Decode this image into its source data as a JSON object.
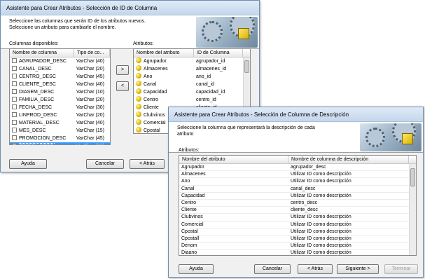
{
  "win1": {
    "title": "Asistente para Crear Atributos - Selección de ID de Columna",
    "banner_line1": "Seleccione las columnas que serán ID de los atributos nuevos.",
    "banner_line2": "Seleccione un atributo para cambiarle el nombre.",
    "columns_label": "Columnas disponibles:",
    "attrs_label": "Atributos:",
    "col_headers": [
      "Nombre de columna",
      "Tipo de co..."
    ],
    "columns": [
      {
        "name": "AGRUPADOR_DESC",
        "type": "VarChar (40)"
      },
      {
        "name": "CANAL_DESC",
        "type": "VarChar (20)"
      },
      {
        "name": "CENTRO_DESC",
        "type": "VarChar (45)"
      },
      {
        "name": "CLIENTE_DESC",
        "type": "VarChar (40)"
      },
      {
        "name": "DIASEM_DESC",
        "type": "VarChar (10)"
      },
      {
        "name": "FAMILIA_DESC",
        "type": "VarChar (20)"
      },
      {
        "name": "FECHA_DESC",
        "type": "VarChar (30)"
      },
      {
        "name": "LINPROD_DESC",
        "type": "VarChar (20)"
      },
      {
        "name": "MATERIAL_DESC",
        "type": "VarChar (40)"
      },
      {
        "name": "MES_DESC",
        "type": "VarChar (15)"
      },
      {
        "name": "PROMOCION_DESC",
        "type": "VarChar (45)"
      },
      {
        "name": "TIPOCL_DESC",
        "type": "VarChar (20)"
      }
    ],
    "attr_headers": [
      "Nombre del atributo",
      "ID de Columna"
    ],
    "attributes": [
      {
        "name": "Agrupador",
        "id": "agrupador_id"
      },
      {
        "name": "Almacenes",
        "id": "almacenes_id"
      },
      {
        "name": "Ano",
        "id": "ano_id"
      },
      {
        "name": "Canal",
        "id": "canal_id"
      },
      {
        "name": "Capacidad",
        "id": "capacidad_id"
      },
      {
        "name": "Centro",
        "id": "centro_id"
      },
      {
        "name": "Cliente",
        "id": "cliente_id"
      },
      {
        "name": "Clubvinos",
        "id": ""
      },
      {
        "name": "Comercial",
        "id": ""
      },
      {
        "name": "Cpostal",
        "id": ""
      },
      {
        "name": "Cpostal",
        "id": ""
      }
    ],
    "move_right": ">",
    "move_left": "<",
    "btn_help": "Ayuda",
    "btn_cancel": "Cancelar",
    "btn_back": "< Atrás"
  },
  "win2": {
    "title": "Asistente para Crear Atributos - Selección de Columna de Descripción",
    "banner_line1": "Seleccione la columna que representará la descripción de cada",
    "banner_line2": "atributo",
    "attrs_label": "Atributos:",
    "headers": [
      "Nombre del atributo",
      "Nombre de columna de descripción"
    ],
    "rows": [
      {
        "name": "Agrupador",
        "desc": "agrupador_desc"
      },
      {
        "name": "Almacenes",
        "desc": "Utilizar ID como descripción"
      },
      {
        "name": "Ano",
        "desc": "Utilizar ID como descripción"
      },
      {
        "name": "Canal",
        "desc": "canal_desc"
      },
      {
        "name": "Capacidad",
        "desc": "Utilizar ID como descripción"
      },
      {
        "name": "Centro",
        "desc": "centro_desc"
      },
      {
        "name": "Cliente",
        "desc": "cliente_desc"
      },
      {
        "name": "Clubvinos",
        "desc": "Utilizar ID como descripción"
      },
      {
        "name": "Comercial",
        "desc": "Utilizar ID como descripción"
      },
      {
        "name": "Cpostal",
        "desc": "Utilizar ID como descripción"
      },
      {
        "name": "Cpostall",
        "desc": "Utilizar ID como descripción"
      },
      {
        "name": "Denom",
        "desc": "Utilizar ID como descripción"
      },
      {
        "name": "Diaano",
        "desc": "Utilizar ID como descripción"
      }
    ],
    "btn_help": "Ayuda",
    "btn_cancel": "Cancelar",
    "btn_back": "< Atrás",
    "btn_next": "Siguiente >",
    "btn_finish": "Terminar"
  },
  "colors": {
    "selection": "#3399ff",
    "title_bg": "#c5d7ec"
  },
  "icons": [
    "gears-banner-icon",
    "column-checkbox-icon",
    "attribute-icon"
  ]
}
